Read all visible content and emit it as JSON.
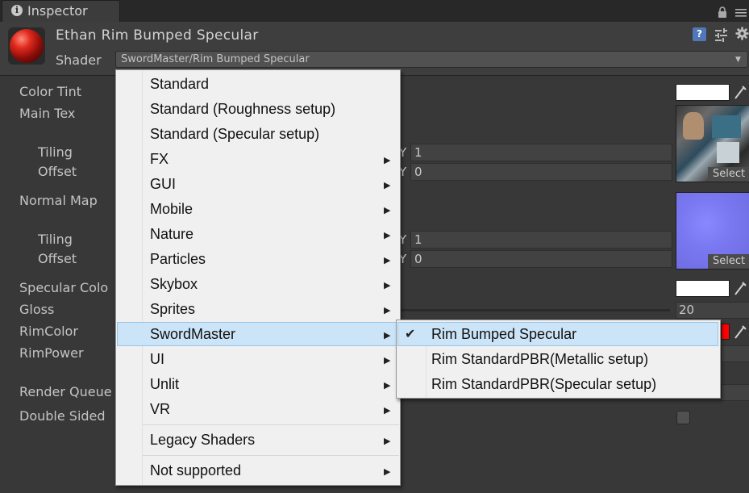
{
  "tab": {
    "title": "Inspector",
    "info_icon": "i"
  },
  "header": {
    "material_name": "Ethan Rim Bumped Specular",
    "shader_label": "Shader",
    "shader_value": "SwordMaster/Rim Bumped Specular",
    "help_glyph": "?"
  },
  "properties": {
    "color_tint": "Color Tint",
    "main_tex": "Main Tex",
    "tiling": "Tiling",
    "offset": "Offset",
    "normal_map": "Normal Map",
    "tiling2": "Tiling",
    "offset2": "Offset",
    "specular_color": "Specular Colo",
    "gloss": "Gloss",
    "gloss_value": "20",
    "rim_color": "RimColor",
    "rim_power": "RimPower",
    "render_queue": "Render Queue",
    "double_sided": "Double Sided",
    "y_axis": "Y",
    "main_tiling_y": "1",
    "main_offset_y": "0",
    "normal_tiling_y": "1",
    "normal_offset_y": "0",
    "select_label": "Select",
    "double_sided_checked": false
  },
  "menu": {
    "items": [
      "Standard",
      "Standard (Roughness setup)",
      "Standard (Specular setup)",
      "FX",
      "GUI",
      "Mobile",
      "Nature",
      "Particles",
      "Skybox",
      "Sprites",
      "SwordMaster",
      "UI",
      "Unlit",
      "VR",
      "Legacy Shaders",
      "Not supported"
    ],
    "highlighted": "SwordMaster",
    "submenu": {
      "items": [
        "Rim Bumped Specular",
        "Rim StandardPBR(Metallic setup)",
        "Rim StandardPBR(Specular setup)"
      ],
      "checked": "Rim Bumped Specular",
      "check_glyph": "✔"
    },
    "arrow_glyph": "▶"
  },
  "colors": {
    "panel_bg": "#383838",
    "menu_bg": "#f0f0f0",
    "highlight": "#cce4f7",
    "rim_color": "#ff0000",
    "accent_blue": "#4f77b9"
  }
}
